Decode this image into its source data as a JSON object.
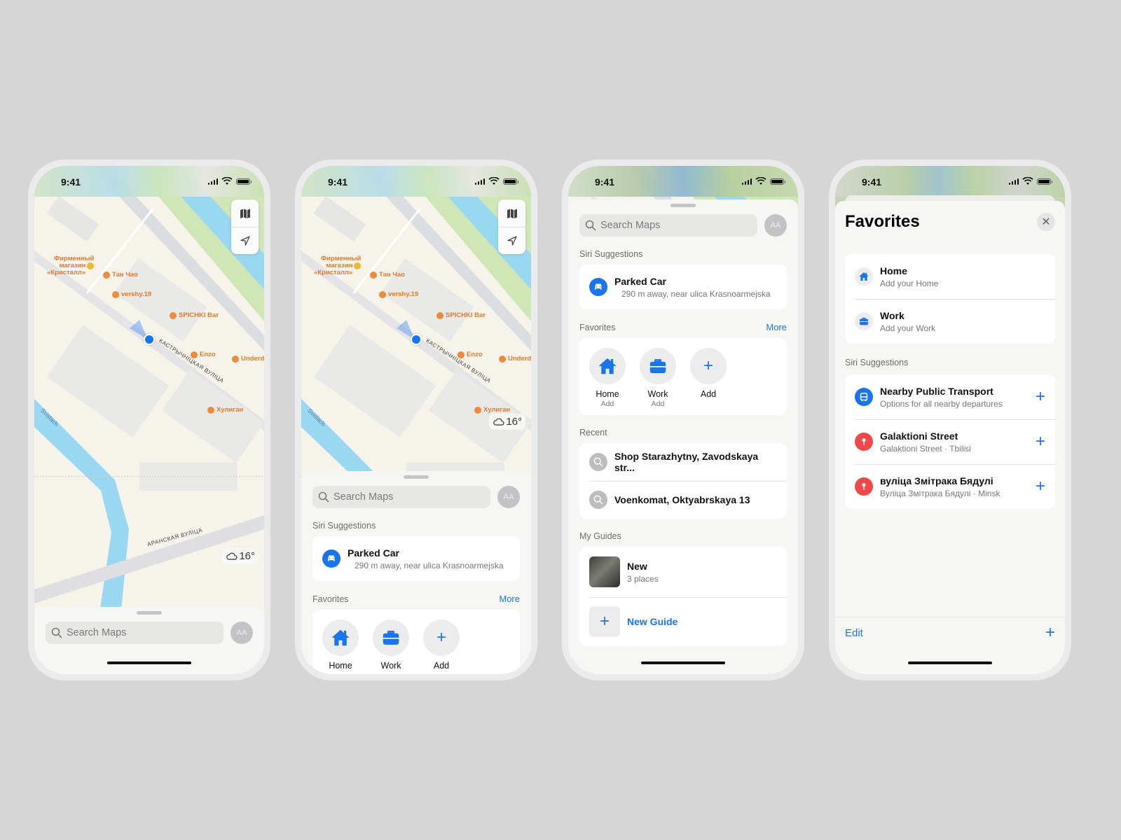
{
  "status": {
    "time": "9:41"
  },
  "map": {
    "pois": [
      {
        "name": "Фирменный магазин «Кристалл»",
        "lines": [
          "Фирменный",
          "магазин",
          "«Кристалл»"
        ],
        "icon": "shop-icon"
      },
      {
        "name": "Тан Чао",
        "icon": "restaurant-icon"
      },
      {
        "name": "vershy.19",
        "icon": "cafe-icon"
      },
      {
        "name": "SPICHKI Bar",
        "icon": "bar-icon"
      },
      {
        "name": "Enzo",
        "icon": "restaurant-icon"
      },
      {
        "name": "Underdog",
        "icon": "pizza-icon"
      },
      {
        "name": "Хулиган",
        "icon": "bar-icon"
      }
    ],
    "streets": {
      "main": "КАСТРЫЧНІЦКАЯ ВУЛІЦА",
      "secondary": "АРАНСКАЯ ВУЛІЦА"
    },
    "river": "Svislach",
    "weather": {
      "temp": "16°",
      "icon": "cloud-icon"
    },
    "controls": {
      "map_mode": "map-icon",
      "locate": "location-arrow-icon"
    }
  },
  "search": {
    "placeholder": "Search Maps",
    "avatar_initials": "AA"
  },
  "siri": {
    "header": "Siri Suggestions",
    "parked_car": {
      "title": "Parked Car",
      "subtitle": "290 m away, near ulica Krasnoarmejska"
    }
  },
  "favorites": {
    "header": "Favorites",
    "more": "More",
    "items": [
      {
        "label": "Home",
        "sub": "Add",
        "icon": "house-icon"
      },
      {
        "label": "Work",
        "sub": "Add",
        "icon": "briefcase-icon"
      },
      {
        "label": "Add",
        "sub": "",
        "icon": "plus-icon"
      }
    ]
  },
  "recent": {
    "header": "Recent",
    "items": [
      {
        "title": "Shop Starazhytny, Zavodskaya str..."
      },
      {
        "title": "Voenkomat, Oktyabrskaya 13"
      }
    ]
  },
  "guides": {
    "header": "My Guides",
    "items": [
      {
        "title": "New",
        "sub": "3 places"
      }
    ],
    "new_guide": "New Guide"
  },
  "favorites_screen": {
    "title": "Favorites",
    "items": [
      {
        "title": "Home",
        "sub": "Add your Home"
      },
      {
        "title": "Work",
        "sub": "Add your Work"
      }
    ],
    "siri_header": "Siri  Suggestions",
    "suggestions": [
      {
        "title": "Nearby Public Transport",
        "sub": "Options for all nearby departures",
        "icon": "bus-icon",
        "color": "#1a74ec"
      },
      {
        "title": "Galaktioni Street",
        "sub": "Galaktioni Street · Tbilisi",
        "icon": "pin-icon",
        "color": "#f0484a"
      },
      {
        "title": "вуліца Змітрака  Бядулі",
        "sub": "Вуліца Змітрака Бядулі · Minsk",
        "icon": "pin-icon",
        "color": "#f0484a"
      }
    ],
    "edit": "Edit"
  },
  "colors": {
    "accent": "#1a74ec",
    "background": "#d6d6d6",
    "poi": "#e07a2e",
    "red": "#f0484a"
  }
}
